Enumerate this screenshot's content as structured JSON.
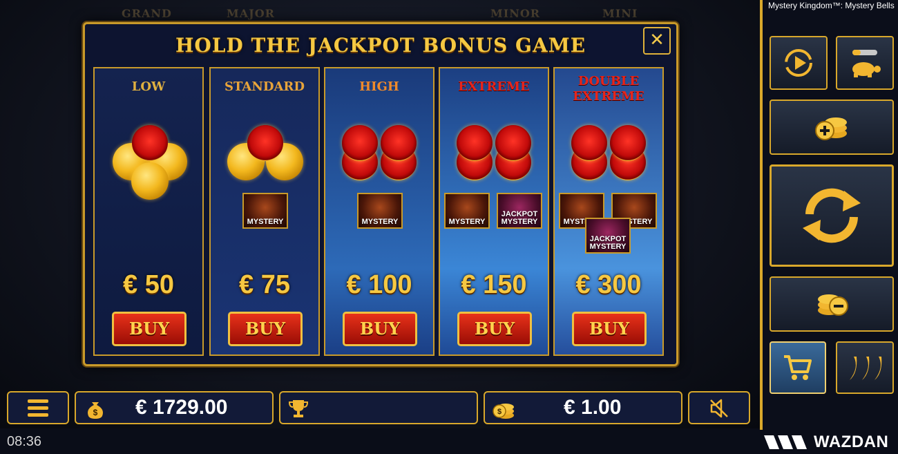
{
  "game_title": "Mystery Kingdom™: Mystery Bells",
  "jackpot_labels": [
    "GRAND",
    "MAJOR",
    "MINOR",
    "MINI"
  ],
  "modal": {
    "title": "HOLD THE JACKPOT BONUS GAME",
    "close_icon": "close-icon",
    "tiers": [
      {
        "name": "LOW",
        "price": "€ 50",
        "buy": "BUY",
        "color": "#e0b040"
      },
      {
        "name": "STANDARD",
        "price": "€ 75",
        "buy": "BUY",
        "color": "#e7a33a"
      },
      {
        "name": "HIGH",
        "price": "€ 100",
        "buy": "BUY",
        "color": "#f08a2a"
      },
      {
        "name": "EXTREME",
        "price": "€ 150",
        "buy": "BUY",
        "color": "#e8241a"
      },
      {
        "name_line1": "DOUBLE",
        "name_line2": "EXTREME",
        "price": "€ 300",
        "buy": "BUY",
        "color": "#e8241a"
      }
    ],
    "mystery_label": "MYSTERY",
    "jackpot_mystery_line1": "JACKPOT",
    "jackpot_mystery_line2": "MYSTERY"
  },
  "bottom": {
    "balance": "€  1729.00",
    "bet": "€  1.00"
  },
  "status": {
    "time": "08:36",
    "brand": "WAZDAN"
  },
  "colors": {
    "accent": "#d9a82b",
    "panel": "#121a38",
    "gold_text": "#f6c842"
  }
}
